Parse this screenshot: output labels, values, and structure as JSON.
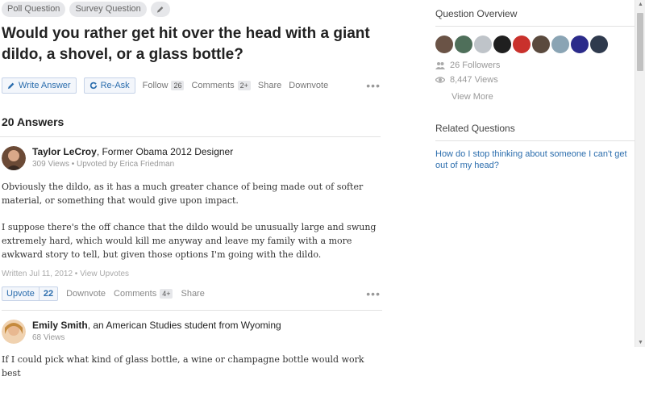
{
  "tags": [
    "Poll Question",
    "Survey Question"
  ],
  "question": {
    "title": "Would you rather get hit over the head with a giant dildo, a shovel, or a glass bottle?",
    "write_answer": "Write Answer",
    "re_ask": "Re-Ask",
    "follow_label": "Follow",
    "follow_count": "26",
    "comments_label": "Comments",
    "comments_count": "2+",
    "share": "Share",
    "downvote": "Downvote",
    "more": "•••"
  },
  "answers_count": "20 Answers",
  "answers": [
    {
      "name": "Taylor LeCroy",
      "credential": ", Former Obama 2012 Designer",
      "meta": "309 Views • Upvoted by Erica Friedman",
      "paragraphs": [
        "Obviously the dildo, as it has a much greater chance of being made out of softer material, or something that would give upon impact.",
        "I suppose there's the off chance that the dildo would be unusually large and swung extremely hard, which would kill me anyway and leave my family with a more awkward story to tell, but given those options I'm going with the dildo."
      ],
      "written": "Written Jul 11, 2012 • View Upvotes",
      "upvote_label": "Upvote",
      "upvote_count": "22",
      "downvote": "Downvote",
      "comments_label": "Comments",
      "comments_count": "4+",
      "share": "Share",
      "more": "•••"
    },
    {
      "name": "Emily Smith",
      "credential": ", an American Studies student from Wyoming",
      "meta": "68 Views",
      "paragraphs": [
        "If I could pick what kind of glass bottle, a wine or champagne bottle would work best"
      ]
    }
  ],
  "sidebar": {
    "overview_title": "Question Overview",
    "followers": "26 Followers",
    "views": "8,447 Views",
    "view_more": "View More",
    "related_title": "Related Questions",
    "related": [
      "How do I stop thinking about someone I can't get out of my head?"
    ]
  },
  "icons": {
    "edit": "pencil-icon",
    "write": "pencil-icon",
    "reask": "refresh-icon",
    "followers": "people-icon",
    "views": "eye-icon"
  },
  "colors": {
    "accent": "#2b6dad",
    "tag_bg": "#e6e7ea"
  }
}
